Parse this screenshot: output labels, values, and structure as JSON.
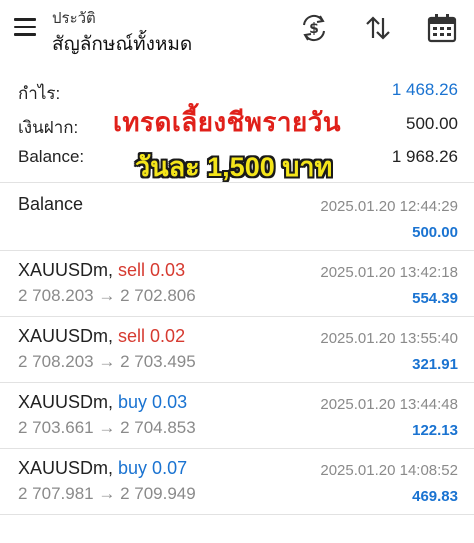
{
  "header": {
    "subtitle": "ประวัติ",
    "title": "สัญลักษณ์ทั้งหมด",
    "icons": [
      "currency-exchange-icon",
      "sort-arrows-icon",
      "calendar-icon"
    ]
  },
  "summary": {
    "profit_label": "กำไร:",
    "profit_value": "1 468.26",
    "deposit_label": "เงินฝาก:",
    "deposit_value": "500.00",
    "balance_label": "Balance:",
    "balance_value": "1 968.26"
  },
  "promo": {
    "line1": "เทรดเลี้ยงชีพรายวัน",
    "line2": "วันละ 1,500 บาท"
  },
  "colors": {
    "blue": "#1a73d1",
    "red": "#d63a30",
    "promo_red": "#e0201a",
    "promo_yellow": "#f4e51a"
  },
  "entries": [
    {
      "title": "Balance",
      "time": "2025.01.20 12:44:29",
      "amount": "500.00"
    },
    {
      "symbol": "XAUUSDm,",
      "action": "sell 0.03",
      "prices": "2 708.203 → 2 702.806",
      "time": "2025.01.20 13:42:18",
      "amount": "554.39"
    },
    {
      "symbol": "XAUUSDm,",
      "action": "sell 0.02",
      "prices": "2 708.203 → 2 703.495",
      "time": "2025.01.20 13:55:40",
      "amount": "321.91"
    },
    {
      "symbol": "XAUUSDm,",
      "action": "buy 0.03",
      "prices": "2 703.661 → 2 704.853",
      "time": "2025.01.20 13:44:48",
      "amount": "122.13"
    },
    {
      "symbol": "XAUUSDm,",
      "action": "buy 0.07",
      "prices": "2 707.981 → 2 709.949",
      "time": "2025.01.20 14:08:52",
      "amount": "469.83"
    }
  ]
}
